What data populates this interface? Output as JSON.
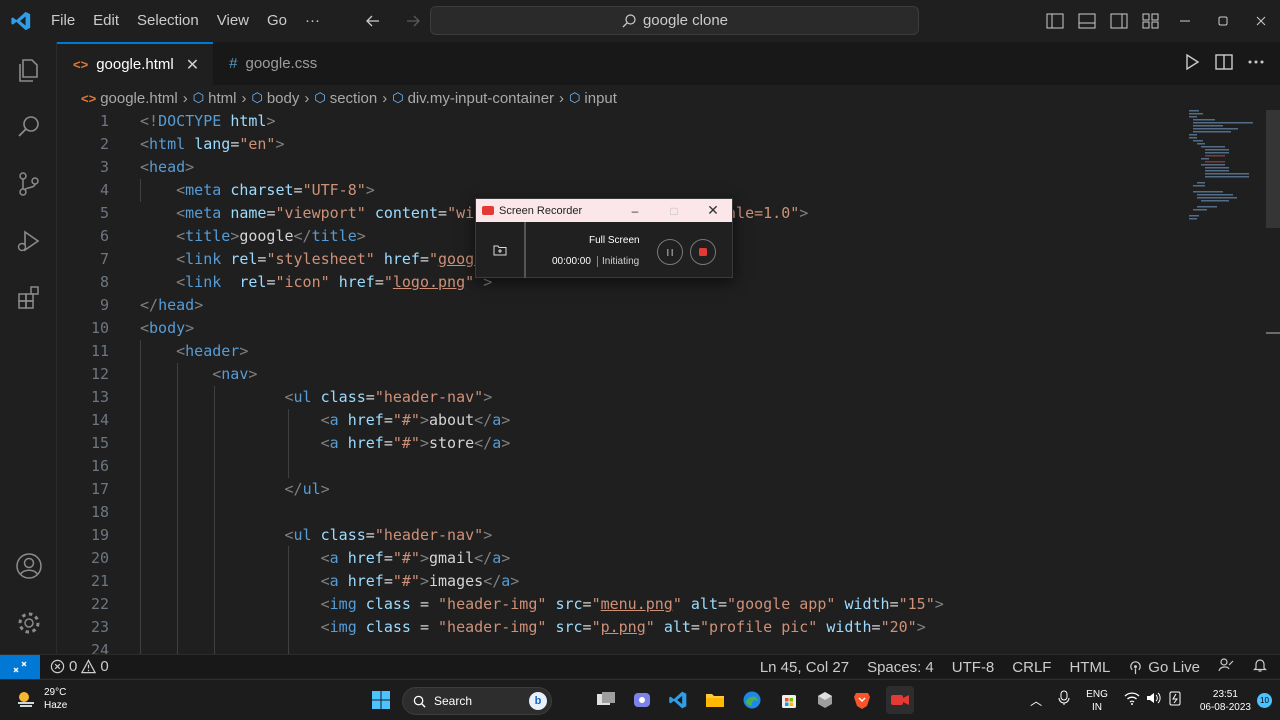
{
  "titlebar": {
    "menu": [
      "File",
      "Edit",
      "Selection",
      "View",
      "Go",
      "···"
    ],
    "search": "google clone"
  },
  "tabs": [
    {
      "label": "google.html",
      "active": true
    },
    {
      "label": "google.css",
      "active": false
    }
  ],
  "breadcrumb": [
    "google.html",
    "html",
    "body",
    "section",
    "div.my-input-container",
    "input"
  ],
  "editor": {
    "lines": [
      {
        "n": "1"
      },
      {
        "n": "2"
      },
      {
        "n": "3"
      },
      {
        "n": "4"
      },
      {
        "n": "5"
      },
      {
        "n": "6"
      },
      {
        "n": "7"
      },
      {
        "n": "8"
      },
      {
        "n": "9"
      },
      {
        "n": "10"
      },
      {
        "n": "11"
      },
      {
        "n": "12"
      },
      {
        "n": "13"
      },
      {
        "n": "14"
      },
      {
        "n": "15"
      },
      {
        "n": "16"
      },
      {
        "n": "17"
      },
      {
        "n": "18"
      },
      {
        "n": "19"
      },
      {
        "n": "20"
      },
      {
        "n": "21"
      },
      {
        "n": "22"
      },
      {
        "n": "23"
      },
      {
        "n": "24"
      }
    ]
  },
  "recorder": {
    "title": "Screen Recorder",
    "mode": "Full Screen",
    "time": "00:00:00",
    "status": "Initiating"
  },
  "statusbar": {
    "errors": "0",
    "warnings": "0",
    "position": "Ln 45, Col 27",
    "spaces": "Spaces: 4",
    "encoding": "UTF-8",
    "eol": "CRLF",
    "language": "HTML",
    "golive": "Go Live"
  },
  "taskbar": {
    "temp": "29°C",
    "weather": "Haze",
    "search": "Search",
    "lang1": "ENG",
    "lang2": "IN",
    "time": "23:51",
    "date": "06-08-2023",
    "notifications": "10"
  },
  "colors": {
    "accent": "#0078d4",
    "tag": "#569cd6",
    "attr": "#9cdcfe",
    "string": "#ce9178",
    "record_red": "#e53935"
  }
}
